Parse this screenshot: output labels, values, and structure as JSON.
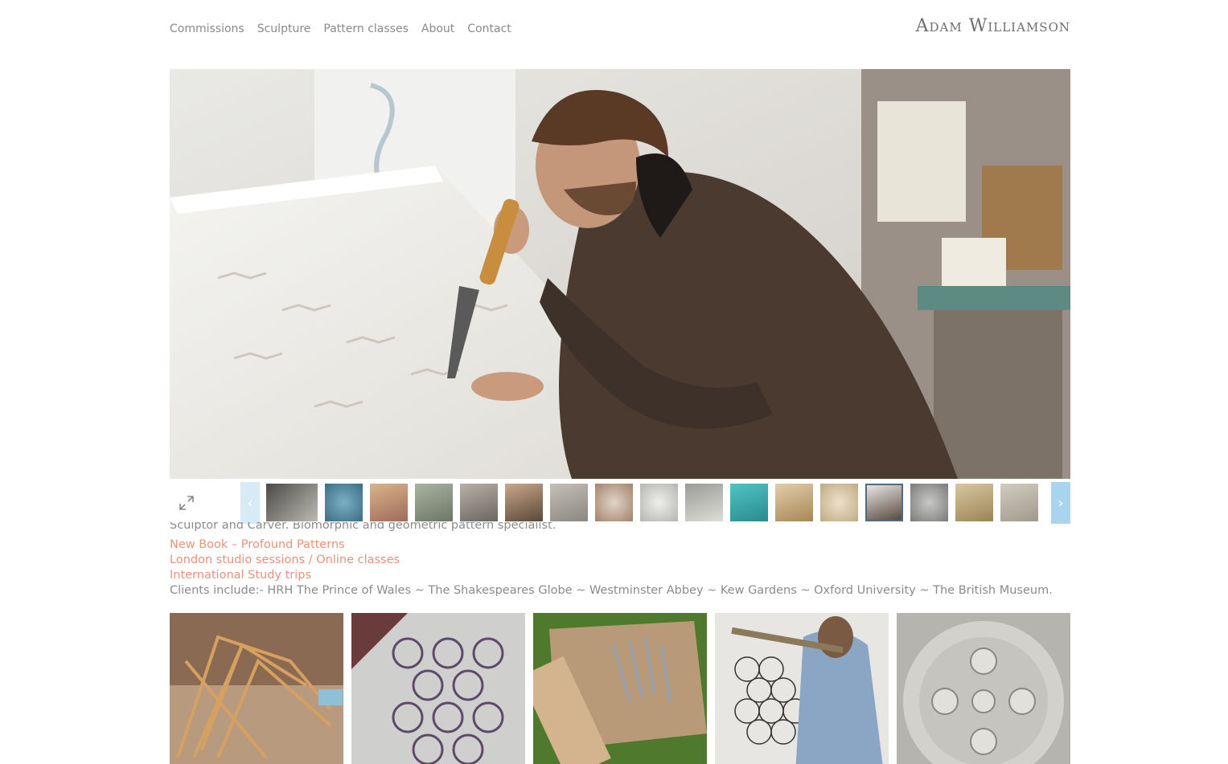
{
  "nav": {
    "items": [
      "Commissions",
      "Sculpture",
      "Pattern classes",
      "About",
      "Contact"
    ]
  },
  "site_title": "Adam Williamson",
  "hero": {
    "image_name": "sculptor-carving-stone-panel"
  },
  "strip": {
    "fullscreen_icon": "expand-icon",
    "prev_label": "‹",
    "next_label": "›",
    "thumb_count": 17,
    "active_index": 13
  },
  "intro": {
    "tagline": "Sculptor and Carver. Biomorphic and geometric pattern specialist.",
    "links": [
      "New Book – Profound Patterns",
      "London studio sessions / Online classes",
      "International Study trips"
    ],
    "clients": "Clients include:- HRH The Prince of Wales ~ The Shakespeares Globe ~ Westminster Abbey ~ Kew Gardens ~ Oxford University ~  The British Museum."
  },
  "colors": {
    "link": "#e8927a",
    "arrow": "#a8d4ee",
    "text": "#8b8b8b"
  }
}
